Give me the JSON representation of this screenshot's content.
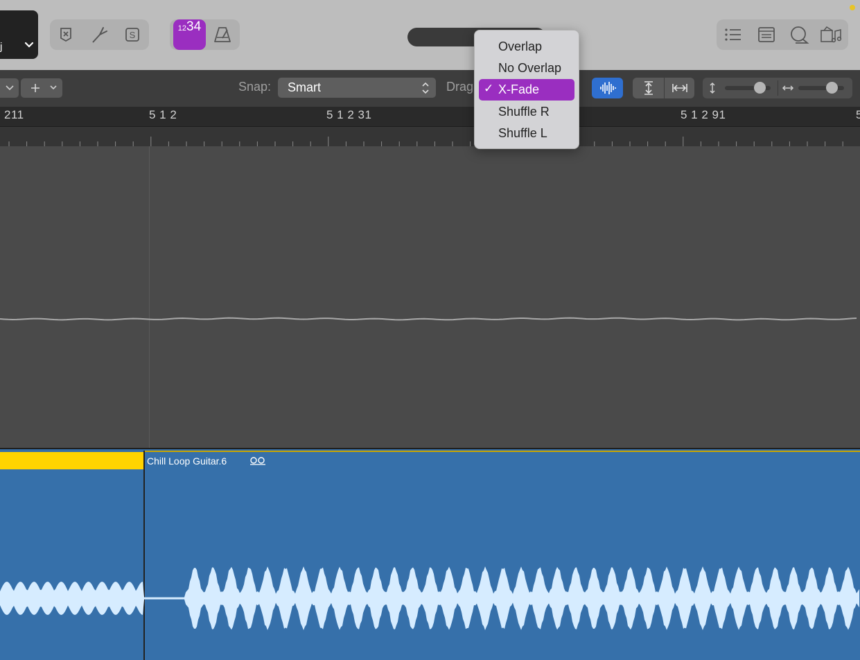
{
  "control_bar": {
    "lcd_text": "j",
    "count_in": {
      "small": "12",
      "big": "34"
    },
    "icons": [
      "replace-icon",
      "tuner-icon",
      "solo-icon",
      "count-in-icon",
      "metronome-icon",
      "list-editors-icon",
      "notepad-icon",
      "loop-browser-icon",
      "media-browser-icon"
    ]
  },
  "toolbar": {
    "snap_label": "Snap:",
    "snap_value": "Smart",
    "drag_label": "Drag"
  },
  "ruler": {
    "labels": [
      "211",
      "5 1 2",
      "5 1 2 31",
      "5 1 2 91",
      "5"
    ]
  },
  "editor": {
    "region_name": "Chill Loop Guitar.6"
  },
  "drag_menu": {
    "items": [
      {
        "label": "Overlap",
        "selected": false
      },
      {
        "label": "No Overlap",
        "selected": false
      },
      {
        "label": "X-Fade",
        "selected": true
      },
      {
        "label": "Shuffle R",
        "selected": false
      },
      {
        "label": "Shuffle L",
        "selected": false
      }
    ],
    "check": "✓"
  },
  "colors": {
    "accent_purple": "#9a2ec0",
    "region_blue": "#3670aa",
    "selection_yellow": "#ffd400",
    "waveform": "#d6ecff"
  }
}
